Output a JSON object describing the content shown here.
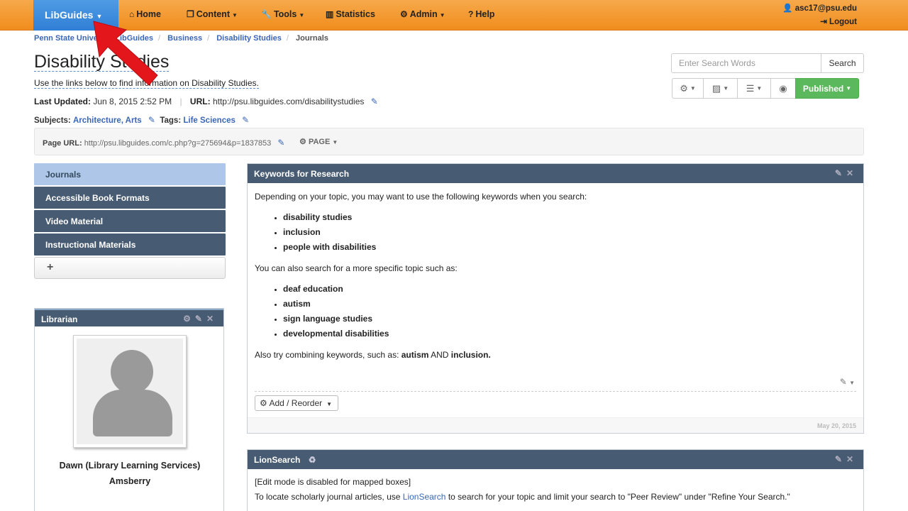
{
  "nav": {
    "brand": "LibGuides",
    "items": [
      {
        "icon": "home-icon",
        "label": "Home",
        "caret": false
      },
      {
        "icon": "content-icon",
        "label": "Content",
        "caret": true
      },
      {
        "icon": "wrench-icon",
        "label": "Tools",
        "caret": true
      },
      {
        "icon": "bar-chart-icon",
        "label": "Statistics",
        "caret": false
      },
      {
        "icon": "admin-icon",
        "label": "Admin",
        "caret": true
      },
      {
        "icon": "help-icon",
        "label": "Help",
        "caret": false
      }
    ],
    "user": "asc17@psu.edu",
    "logout": "Logout"
  },
  "breadcrumb": {
    "items": [
      "Penn State Univer",
      "LibGuides",
      "Business",
      "Disability Studies"
    ],
    "current": "Journals"
  },
  "page": {
    "title": "Disability Studies",
    "description": "Use the links below to find information on Disability Studies.",
    "last_updated_label": "Last Updated:",
    "last_updated": "Jun 8, 2015 2:52 PM",
    "url_label": "URL:",
    "url": "http://psu.libguides.com/disabilitystudies",
    "subjects_label": "Subjects:",
    "subjects": "Architecture, Arts",
    "tags_label": "Tags:",
    "tags": "Life Sciences",
    "page_url_label": "Page URL:",
    "page_url": "http://psu.libguides.com/c.php?g=275694&p=1837853",
    "page_button": "PAGE"
  },
  "search": {
    "placeholder": "Enter Search Words",
    "button": "Search"
  },
  "toolbar": {
    "published": "Published"
  },
  "sidebar": {
    "tabs": [
      "Journals",
      "Accessible Book Formats",
      "Video Material",
      "Instructional Materials"
    ],
    "add": "+"
  },
  "librarian": {
    "title": "Librarian",
    "name_line1": "Dawn (Library Learning Services)",
    "name_line2": "Amsberry"
  },
  "keywords_box": {
    "title": "Keywords for Research",
    "intro": "Depending on your topic, you may want to use the following keywords when you search:",
    "list1": [
      "disability studies",
      "inclusion",
      "people with disabilities"
    ],
    "mid": "You can also search for a more specific topic such as:",
    "list2": [
      "deaf education",
      "autism",
      "sign language studies",
      "developmental disabilities"
    ],
    "combine_prefix": "Also try combining keywords, such as: ",
    "combine_a": "autism",
    "combine_and": " AND ",
    "combine_b": "inclusion.",
    "add_reorder": "Add / Reorder",
    "date": "May 20, 2015"
  },
  "lion_box": {
    "title": "LionSearch",
    "line1": "[Edit mode is disabled for mapped boxes]",
    "line2_prefix": "To locate scholarly journal articles, use ",
    "line2_link": "LionSearch",
    "line2_suffix": " to search for your topic and limit your search to \"Peer Review\" under \"Refine Your Search.\""
  },
  "colors": {
    "nav_orange": "#f08d1c",
    "brand_blue": "#2f7fd6",
    "panel_header": "#475b73",
    "active_tab": "#aec7e8",
    "published_green": "#5cb85c",
    "arrow_red": "#e3161b"
  }
}
